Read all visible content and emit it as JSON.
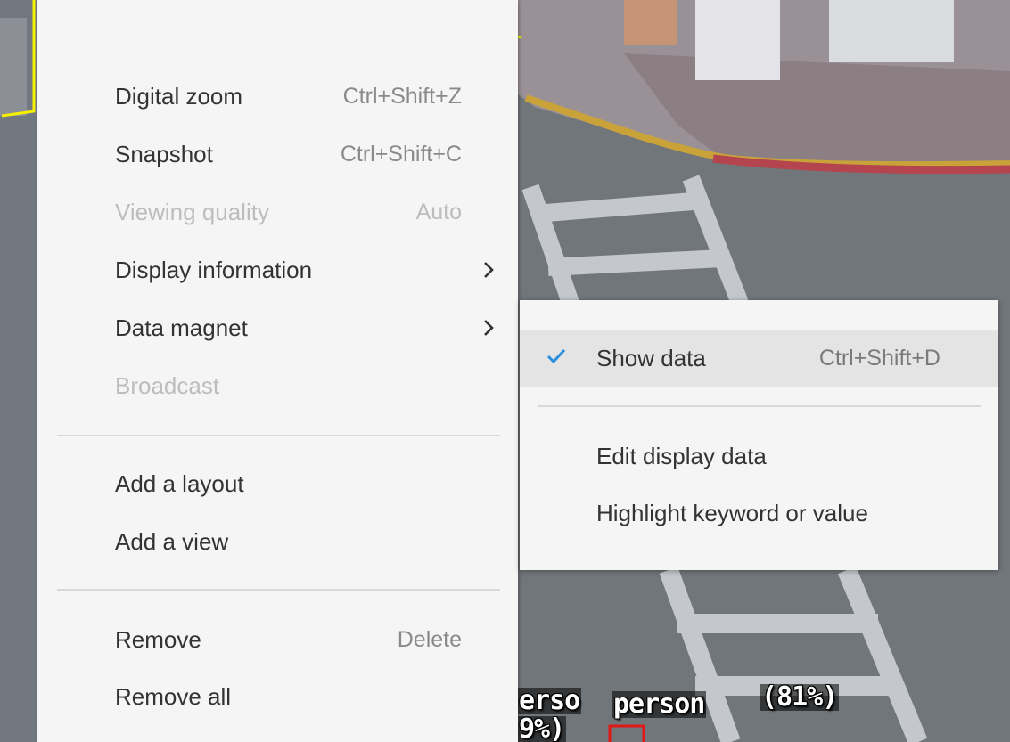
{
  "menu": {
    "items": [
      {
        "label": "Digital zoom",
        "shortcut": "Ctrl+Shift+Z"
      },
      {
        "label": "Snapshot",
        "shortcut": "Ctrl+Shift+C"
      },
      {
        "label": "Viewing quality",
        "shortcut": "Auto",
        "disabled": true
      },
      {
        "label": "Display information",
        "has_submenu": true
      },
      {
        "label": "Data magnet",
        "has_submenu": true
      },
      {
        "label": "Broadcast",
        "disabled": true
      },
      {
        "label": "Add a layout"
      },
      {
        "label": "Add a view"
      },
      {
        "label": "Remove",
        "shortcut": "Delete"
      },
      {
        "label": "Remove all"
      }
    ]
  },
  "submenu": {
    "items": [
      {
        "label": "Show data",
        "shortcut": "Ctrl+Shift+D",
        "checked": true
      },
      {
        "label": "Edit display data"
      },
      {
        "label": "Highlight keyword or value"
      }
    ]
  },
  "overlay": {
    "label_1": "erso",
    "label_2": "person",
    "label_3": "(81%)",
    "label_4": "9%)"
  },
  "icons": {
    "submenu_arrow": "chevron-right-icon",
    "check": "checkmark-icon"
  },
  "colors": {
    "menu_bg": "#f5f5f5",
    "text": "#333333",
    "disabled_text": "#bdbdbd",
    "check_accent": "#2b8fe0",
    "highlight_bg": "#e4e4e4"
  }
}
